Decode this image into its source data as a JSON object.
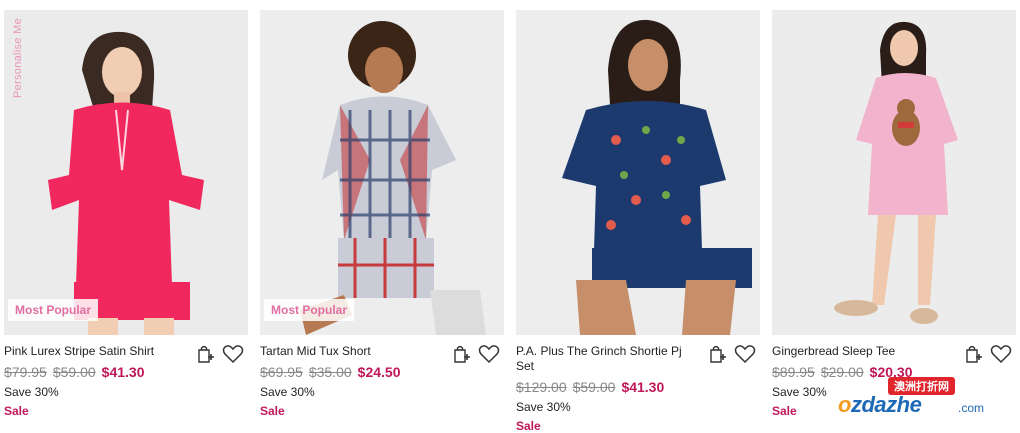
{
  "products": [
    {
      "name": "Pink Lurex Stripe Satin Shirt",
      "badge": "Most Popular",
      "side_label": "Personalise Me",
      "was_price": "$79.95",
      "mid_price": "$59.00",
      "price": "$41.30",
      "save": "Save 30%",
      "sale": "Sale",
      "colors": {
        "garment": "#f0285e",
        "background": "#ebebeb"
      }
    },
    {
      "name": "Tartan Mid Tux Short",
      "badge": "Most Popular",
      "was_price": "$69.95",
      "mid_price": "$35.00",
      "price": "$24.50",
      "save": "Save 30%",
      "sale": "Sale",
      "colors": {
        "garment": "#c73a3d",
        "background": "#ededed"
      }
    },
    {
      "name": "P.A. Plus The Grinch Shortie Pj Set",
      "was_price": "$129.00",
      "mid_price": "$59.00",
      "price": "$41.30",
      "save": "Save 30%",
      "sale": "Sale",
      "colors": {
        "garment": "#1c3a6e",
        "background": "#ededed"
      }
    },
    {
      "name": "Gingerbread Sleep Tee",
      "was_price": "$89.95",
      "mid_price": "$29.00",
      "price": "$20.30",
      "save": "Save 30%",
      "sale": "Sale",
      "colors": {
        "garment": "#f2b3cc",
        "background": "#ececec"
      }
    }
  ],
  "icons": {
    "bag": "bag-plus-icon",
    "wishlist": "heart-icon"
  },
  "watermark": {
    "top": "澳洲打折网",
    "brand_o": "o",
    "brand_rest": "zdazhe",
    "domain": ".com"
  },
  "accent_color": "#c0175a"
}
